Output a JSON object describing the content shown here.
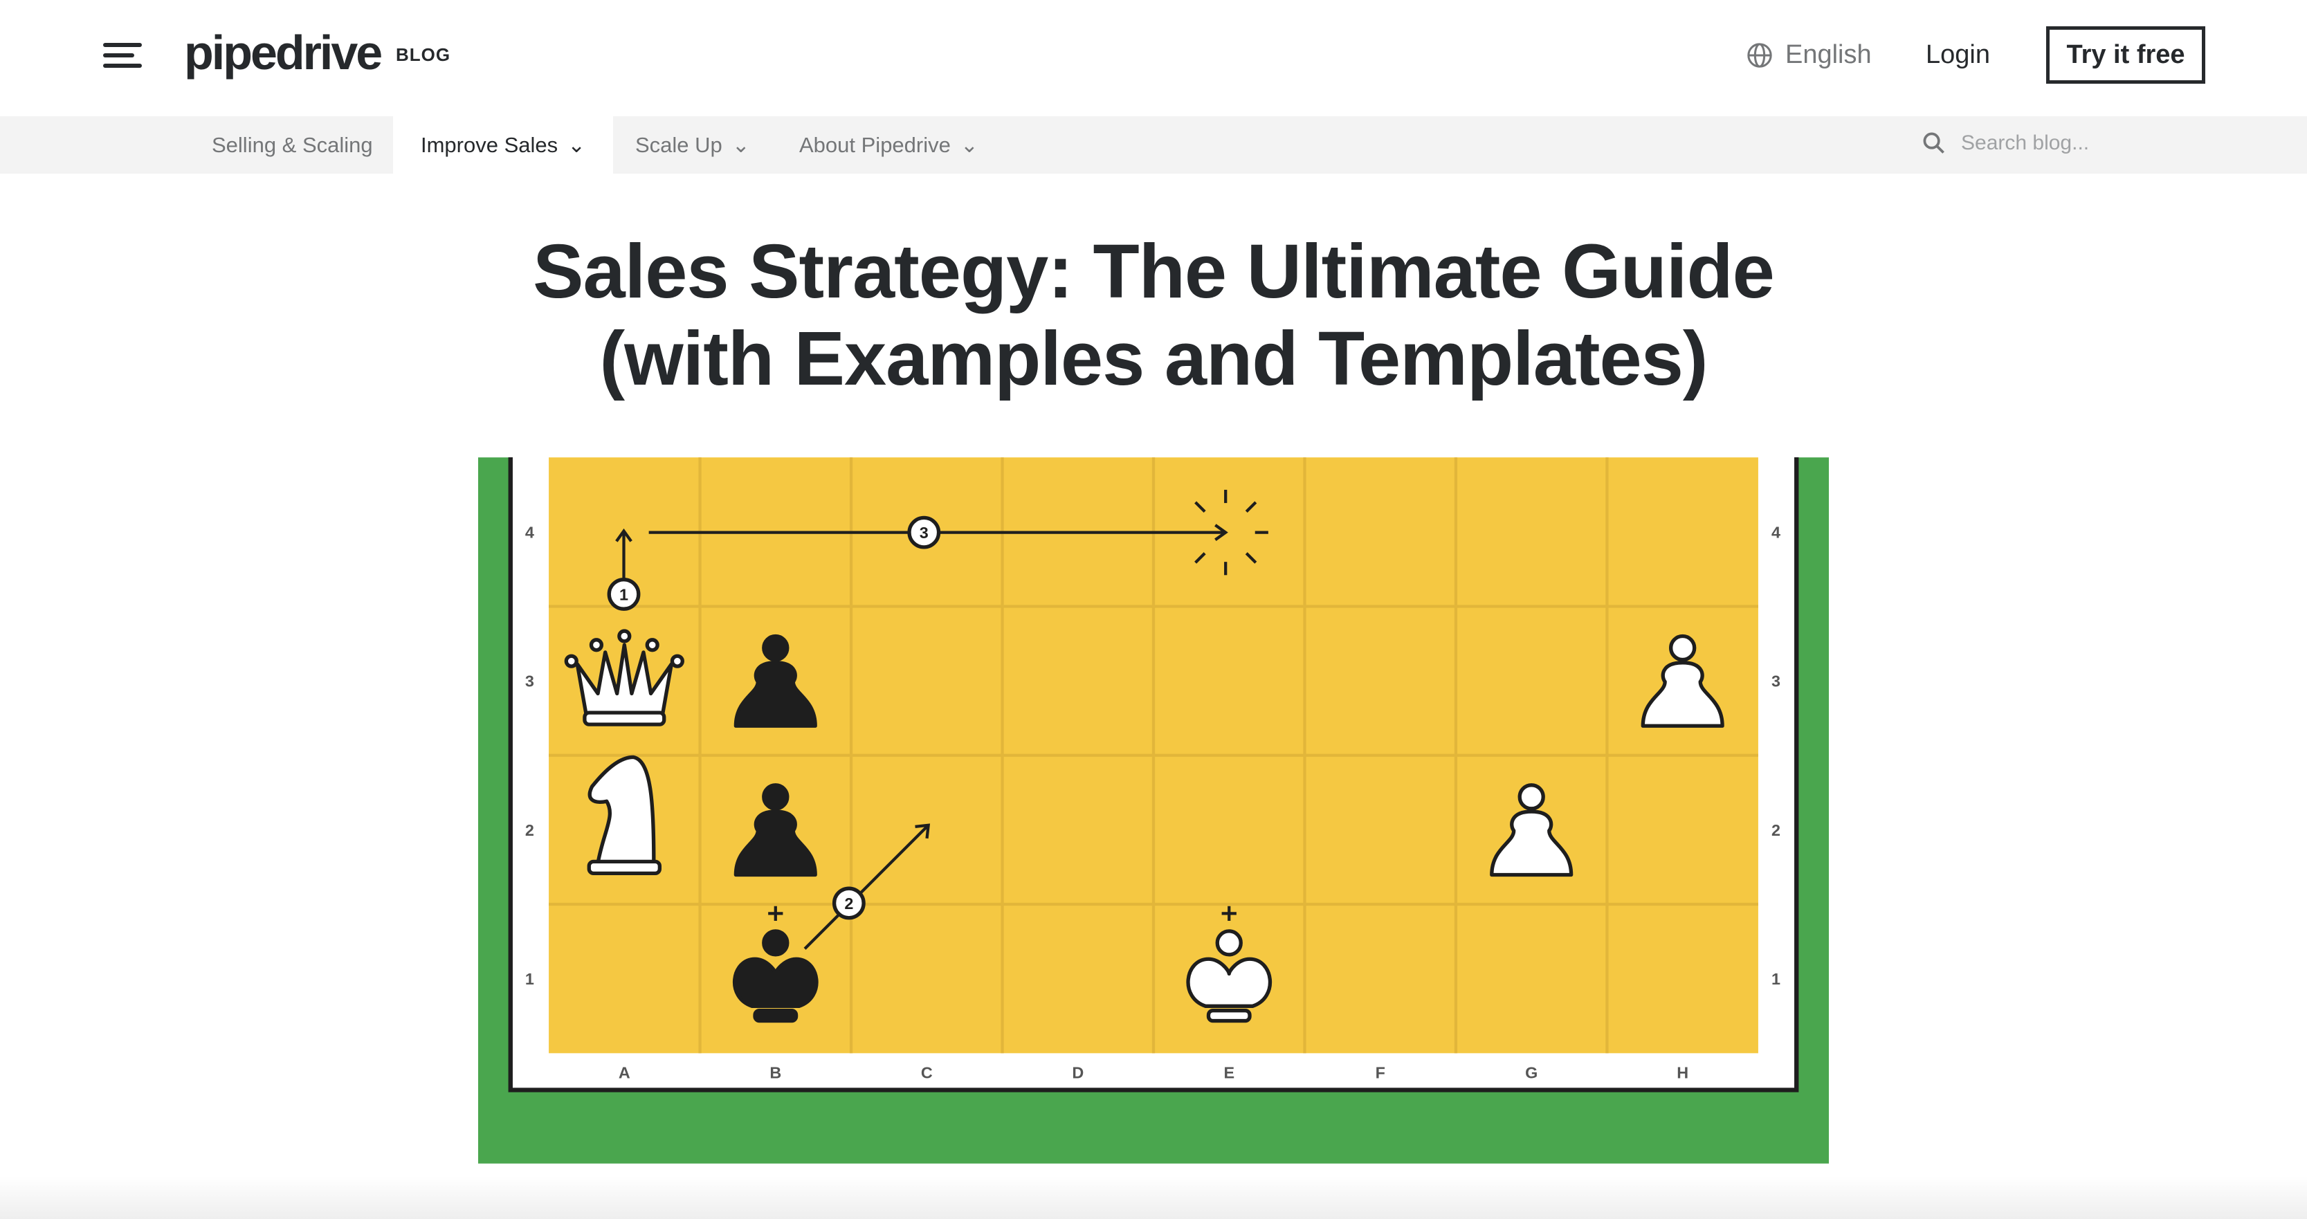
{
  "header": {
    "logo": "pipedrive",
    "logo_suffix": "BLOG",
    "language": "English",
    "login": "Login",
    "cta": "Try it free"
  },
  "nav": {
    "items": [
      {
        "label": "Selling & Scaling",
        "dropdown": false
      },
      {
        "label": "Improve Sales",
        "dropdown": true,
        "active": true
      },
      {
        "label": "Scale Up",
        "dropdown": true
      },
      {
        "label": "About Pipedrive",
        "dropdown": true
      }
    ],
    "search_placeholder": "Search blog..."
  },
  "article": {
    "title_line1": "Sales Strategy: The Ultimate Guide",
    "title_line2": "(with Examples and Templates)"
  },
  "hero": {
    "colors": {
      "background": "#4aa64e",
      "board": "#f5c842",
      "grid": "#e2b63a",
      "ink": "#1e1e1e"
    },
    "files": [
      "A",
      "B",
      "C",
      "D",
      "E",
      "F",
      "G",
      "H"
    ],
    "ranks": [
      "4",
      "3",
      "2",
      "1"
    ],
    "pieces": [
      {
        "square": "a3",
        "type": "queen",
        "color": "white"
      },
      {
        "square": "b3",
        "type": "pawn",
        "color": "black"
      },
      {
        "square": "h3",
        "type": "pawn",
        "color": "white"
      },
      {
        "square": "a2",
        "type": "knight",
        "color": "white"
      },
      {
        "square": "b2",
        "type": "pawn",
        "color": "black"
      },
      {
        "square": "g2",
        "type": "pawn",
        "color": "white"
      },
      {
        "square": "b1",
        "type": "king",
        "color": "black"
      },
      {
        "square": "e1",
        "type": "king",
        "color": "white"
      }
    ],
    "steps": [
      "1",
      "2",
      "3"
    ]
  }
}
